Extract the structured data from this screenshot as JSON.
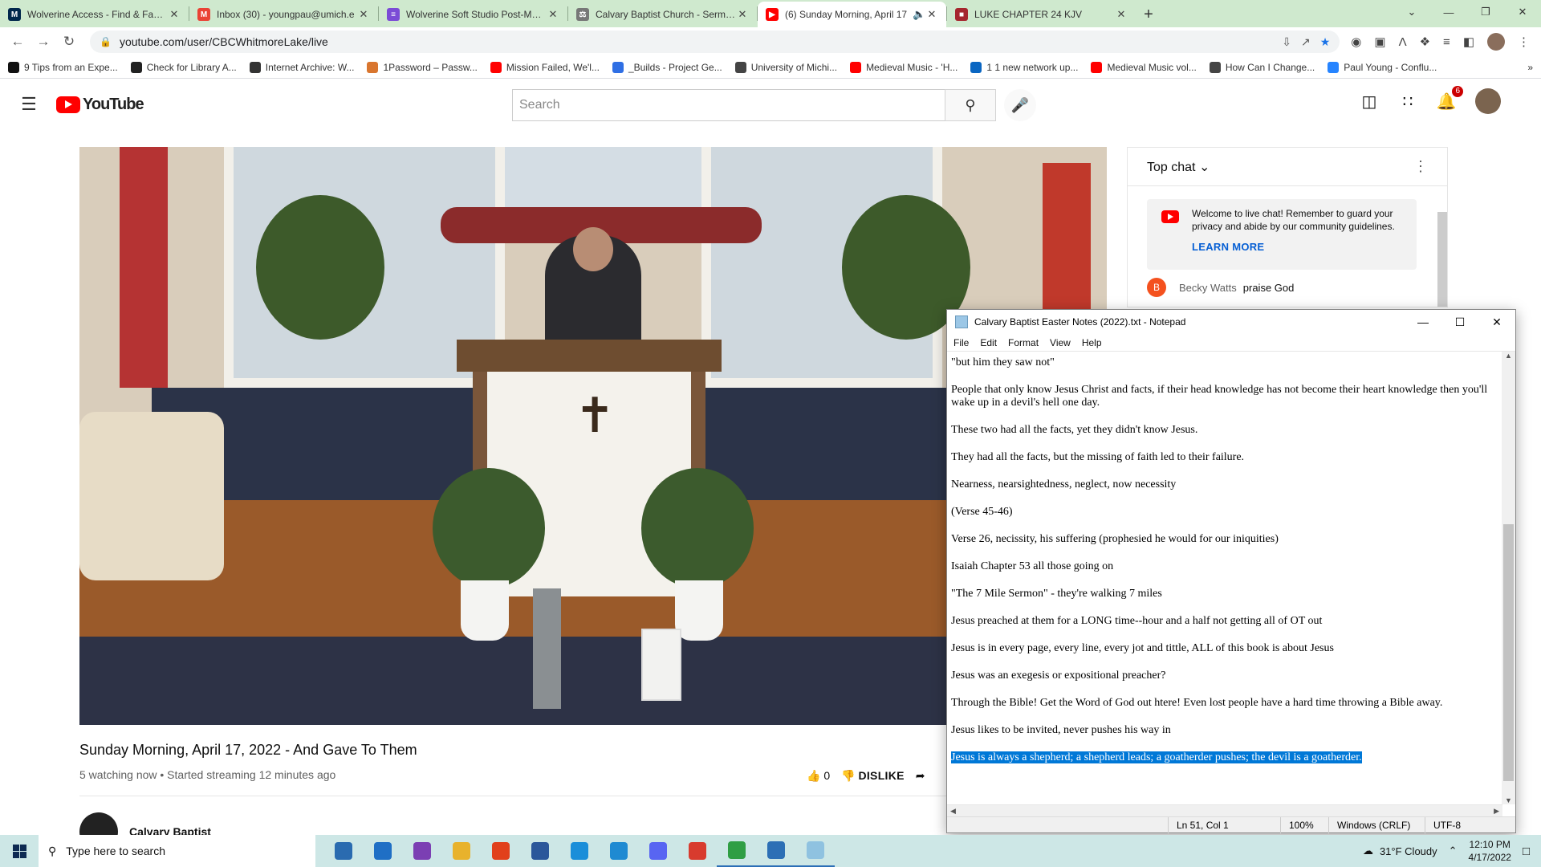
{
  "browser": {
    "tabs": [
      {
        "title": "Wolverine Access - Find & Favori",
        "color": "#00274c",
        "glyph": "M"
      },
      {
        "title": "Inbox (30) - youngpau@umich.e",
        "color": "#ea4335",
        "glyph": "M"
      },
      {
        "title": "Wolverine Soft Studio Post-Morte",
        "color": "#7b4bd6",
        "glyph": "≡"
      },
      {
        "title": "Calvary Baptist Church - Sermons",
        "color": "#777777",
        "glyph": "⚖"
      },
      {
        "title": "(6) Sunday Morning, April 17",
        "color": "#ff0000",
        "glyph": "▶"
      },
      {
        "title": "LUKE CHAPTER 24 KJV",
        "color": "#a5262e",
        "glyph": "■"
      }
    ],
    "url": "youtube.com/user/CBCWhitmoreLake/live",
    "bookmarks": [
      {
        "label": "9 Tips from an Expe...",
        "color": "#111111"
      },
      {
        "label": "Check for Library A...",
        "color": "#222222"
      },
      {
        "label": "Internet Archive: W...",
        "color": "#333333"
      },
      {
        "label": "1Password – Passw...",
        "color": "#d9762f"
      },
      {
        "label": "Mission Failed, We'l...",
        "color": "#ff0000"
      },
      {
        "label": "_Builds - Project Ge...",
        "color": "#2f6fe4"
      },
      {
        "label": "University of Michi...",
        "color": "#444444"
      },
      {
        "label": "Medieval Music - 'H...",
        "color": "#ff0000"
      },
      {
        "label": "1 1 new network up...",
        "color": "#0a66c2"
      },
      {
        "label": "Medieval Music vol...",
        "color": "#ff0000"
      },
      {
        "label": "How Can I Change...",
        "color": "#444444"
      },
      {
        "label": "Paul Young - Conflu...",
        "color": "#2684ff"
      }
    ]
  },
  "youtube": {
    "logo": "YouTube",
    "search_placeholder": "Search",
    "notifications": "6",
    "video_title": "Sunday Morning, April 17, 2022 - And Gave To Them",
    "video_meta": "5 watching now • Started streaming 12 minutes ago",
    "likes": "0",
    "dislike_label": "DISLIKE",
    "channel": "Calvary Baptist"
  },
  "chat": {
    "header": "Top chat",
    "welcome": "Welcome to live chat! Remember to guard your privacy and abide by our community guidelines.",
    "learn_more": "LEARN MORE",
    "messages": [
      {
        "initial": "B",
        "author": "Becky Watts",
        "text": "praise God"
      }
    ]
  },
  "notepad": {
    "title": "Calvary Baptist Easter Notes (2022).txt - Notepad",
    "menu": [
      "File",
      "Edit",
      "Format",
      "View",
      "Help"
    ],
    "lines": [
      "\"but him they saw not\"",
      "People that only know Jesus Christ and facts, if their head knowledge has not become their heart knowledge then you'll wake up in a devil's hell one day.",
      "These two had all the facts, yet they didn't know Jesus.",
      "They had all the facts, but the missing of faith led to their failure.",
      "Nearness, nearsightedness, neglect, now necessity",
      "(Verse 45-46)",
      "Verse 26, necissity, his suffering (prophesied he would for our iniquities)",
      "Isaiah Chapter 53 all those going on",
      "\"The 7 Mile Sermon\" - they're walking 7 miles",
      "Jesus preached at them for a LONG time--hour and a half not getting all of OT out",
      "Jesus is in every page, every line, every jot and tittle, ALL of this book is about Jesus",
      "Jesus was an exegesis or expositional preacher?",
      "Through the Bible! Get the Word of God out htere! Even lost people have a hard time throwing a Bible away.",
      "Jesus likes to be invited, never pushes his way in"
    ],
    "selected_line": "Jesus is always a shepherd; a shepherd leads; a goatherder pushes; the devil is a goatherder.",
    "status": {
      "position": "Ln 51, Col 1",
      "zoom": "100%",
      "eol": "Windows (CRLF)",
      "encoding": "UTF-8"
    }
  },
  "taskbar": {
    "search_placeholder": "Type here to search",
    "apps": [
      {
        "name": "task-view",
        "color": "#2a6bb0"
      },
      {
        "name": "mail",
        "color": "#1f6fc5"
      },
      {
        "name": "podcast",
        "color": "#7b3fb3"
      },
      {
        "name": "file-explorer",
        "color": "#e8b22c"
      },
      {
        "name": "office",
        "color": "#e1401c"
      },
      {
        "name": "word",
        "color": "#2b579a"
      },
      {
        "name": "edge",
        "color": "#1a8ed9"
      },
      {
        "name": "vscode",
        "color": "#1f8ad2"
      },
      {
        "name": "discord",
        "color": "#5865f2"
      },
      {
        "name": "music",
        "color": "#d83b2e"
      },
      {
        "name": "chrome",
        "color": "#2f9e44"
      },
      {
        "name": "photos",
        "color": "#2c6fb5"
      },
      {
        "name": "notepad",
        "color": "#8fc2e0"
      }
    ],
    "weather": "31°F  Cloudy",
    "time": "12:10 PM",
    "date": "4/17/2022"
  }
}
